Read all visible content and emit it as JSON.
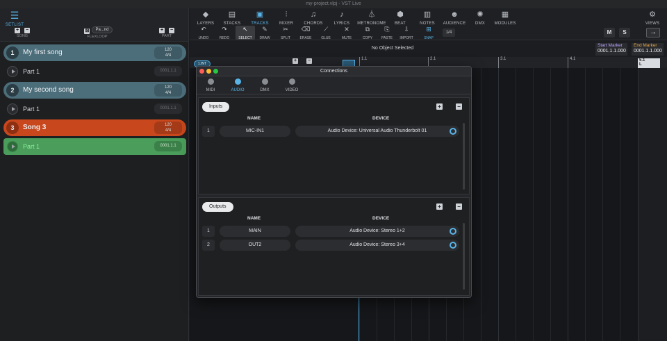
{
  "window": {
    "title": "my-project.vlpj - VST Live"
  },
  "left": {
    "setlist_label": "SETLIST",
    "song_label": "SONG",
    "flexloop_label": "FLEXLOOP",
    "flexloop_value": "Pa...nd",
    "part_label": "PART",
    "items": [
      {
        "type": "song",
        "num": "1",
        "name": "My first song",
        "tempo": "120",
        "sig": "4/4"
      },
      {
        "type": "part",
        "name": "Part 1",
        "time": "0001.1.1"
      },
      {
        "type": "song",
        "num": "2",
        "name": "My second song",
        "tempo": "120",
        "sig": "4/4"
      },
      {
        "type": "part",
        "name": "Part 1",
        "time": "0001.1.1"
      },
      {
        "type": "song",
        "num": "3",
        "name": "Song 3",
        "tempo": "120",
        "sig": "4/4"
      },
      {
        "type": "part",
        "name": "Part 1",
        "time": "0001.1.1"
      }
    ]
  },
  "nav": [
    "LAYERS",
    "STACKS",
    "TRACKS",
    "MIXER",
    "CHORDS",
    "LYRICS",
    "METRONOME",
    "BEAT",
    "NOTES",
    "AUDIENCE",
    "DMX",
    "MODULES"
  ],
  "views_label": "VIEWS",
  "tools": [
    "UNDO",
    "REDO",
    "SELECT",
    "DRAW",
    "SPLIT",
    "ERASE",
    "GLUE",
    "MUTE",
    "COPY",
    "PASTE",
    "IMPORT",
    "SNAP"
  ],
  "snap_value": "1/4",
  "mute_btn": "M",
  "solo_btn": "S",
  "exit_icon": "→",
  "status": "No Object Selected",
  "start_marker": {
    "label": "Start Marker",
    "value": "0001.1.1.000"
  },
  "end_marker": {
    "label": "End Marker",
    "value": "0001.1.1.000"
  },
  "ruler": [
    "1.1",
    "2.1",
    "3.1",
    "4.1",
    "5.1"
  ],
  "timeline": {
    "intro_tag": "1.INT",
    "locator_label": "L"
  },
  "dialog": {
    "title": "Connections",
    "tabs": [
      "MIDI",
      "AUDIO",
      "DMX",
      "VIDEO"
    ],
    "inputs_label": "Inputs",
    "outputs_label": "Outputs",
    "col_name": "NAME",
    "col_device": "DEVICE",
    "inputs": [
      {
        "idx": "1",
        "name": "MIC-IN1",
        "device": "Audio Device: Universal Audio Thunderbolt 01"
      }
    ],
    "outputs": [
      {
        "idx": "1",
        "name": "MAIN",
        "device": "Audio Device: Stereo 1+2"
      },
      {
        "idx": "2",
        "name": "OUT2",
        "device": "Audio Device: Stereo 3+4"
      }
    ]
  },
  "colors": {
    "accent": "#58b4e8",
    "song_blue": "#4c6e7b",
    "song_active": "#c8471d",
    "part_active": "#4a9d5a"
  }
}
